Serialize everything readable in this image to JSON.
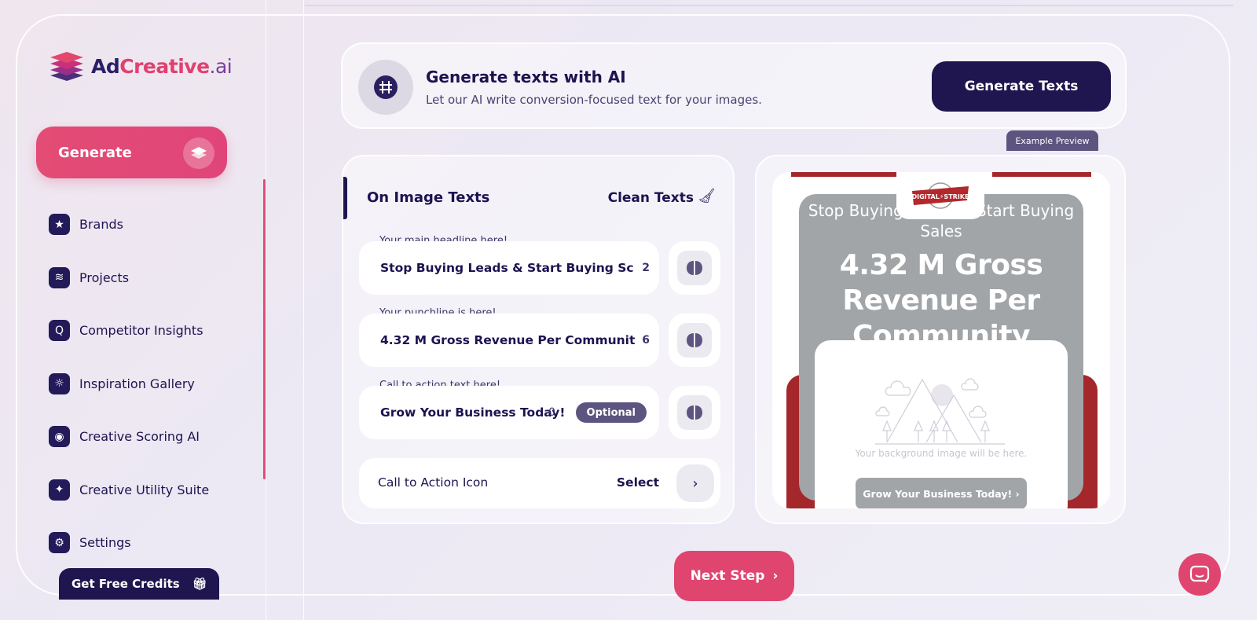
{
  "brand": {
    "name_part1": "Ad",
    "name_part2": "Creative",
    "name_part3": ".ai"
  },
  "sidebar": {
    "generate_label": "Generate",
    "items": [
      {
        "label": "Brands",
        "icon": "star-icon"
      },
      {
        "label": "Projects",
        "icon": "layers-icon"
      },
      {
        "label": "Competitor Insights",
        "icon": "search-icon"
      },
      {
        "label": "Inspiration Gallery",
        "icon": "lightbulb-icon"
      },
      {
        "label": "Creative Scoring AI",
        "icon": "score-icon"
      },
      {
        "label": "Creative Utility Suite",
        "icon": "magic-wand-icon"
      },
      {
        "label": "Settings",
        "icon": "gear-icon"
      }
    ],
    "credits_label": "Get Free Credits"
  },
  "ai_banner": {
    "title": "Generate texts with AI",
    "subtitle": "Let our AI write conversion-focused text for your images.",
    "button": "Generate Texts"
  },
  "texts": {
    "title": "On Image Texts",
    "clean_label": "Clean Texts",
    "fields": [
      {
        "label": "Your main headline here!",
        "value": "Stop Buying Leads & Start Buying Sc",
        "count": "2"
      },
      {
        "label": "Your punchline is here!",
        "value": "4.32 M Gross Revenue Per Communit",
        "count": "6"
      },
      {
        "label": "Call to action text here!",
        "value": "Grow Your Business Today!",
        "count": "0",
        "badge": "Optional"
      }
    ],
    "cta_icon_label": "Call to Action Icon",
    "cta_icon_select": "Select"
  },
  "preview": {
    "tag": "Example Preview",
    "logo_text": "DIGITAL STRIKE",
    "headline": "Stop Buying Leads & Start Buying Sales",
    "punchline": "4.32 M Gross Revenue Per Community",
    "bg_placeholder": "Your background image will be here.",
    "cta": "Grow Your Business Today!",
    "colors": {
      "brand_red": "#a4282b",
      "grey": "#a2a5a8"
    }
  },
  "next_label": "Next Step",
  "colors": {
    "accent": "#e0456f",
    "navy": "#1f164f"
  }
}
